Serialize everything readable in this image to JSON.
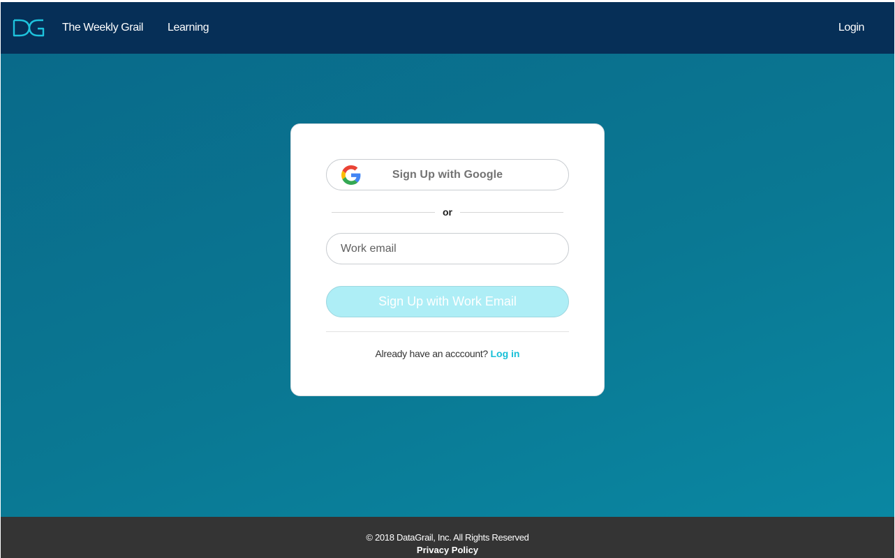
{
  "header": {
    "nav": {
      "weekly_grail": "The Weekly Grail",
      "learning": "Learning",
      "login": "Login"
    }
  },
  "card": {
    "google_button_label": "Sign Up with Google",
    "divider_text": "or",
    "email_placeholder": "Work email",
    "email_button_label": "Sign Up with Work Email",
    "already_text": "Already have an acccount?",
    "login_link": "Log in"
  },
  "footer": {
    "copyright": "© 2018 DataGrail, Inc. All Rights Reserved",
    "privacy": "Privacy Policy"
  },
  "colors": {
    "header_bg": "#062f57",
    "accent": "#17bfd7",
    "footer_bg": "#343434",
    "email_button_bg": "#aeeef6"
  },
  "icons": {
    "logo": "datagrail-logo-icon",
    "google": "google-g-icon"
  }
}
